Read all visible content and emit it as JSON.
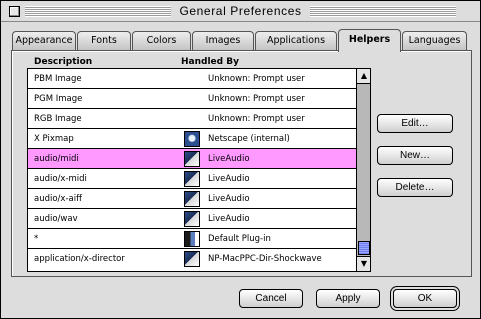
{
  "window": {
    "title": "General Preferences"
  },
  "tabs": [
    {
      "label": "Appearance",
      "active": false
    },
    {
      "label": "Fonts",
      "active": false
    },
    {
      "label": "Colors",
      "active": false
    },
    {
      "label": "Images",
      "active": false
    },
    {
      "label": "Applications",
      "active": false
    },
    {
      "label": "Helpers",
      "active": true
    },
    {
      "label": "Languages",
      "active": false
    }
  ],
  "table": {
    "columns": {
      "description": "Description",
      "handled_by": "Handled By"
    },
    "rows": [
      {
        "description": "PBM Image",
        "handled_by": "Unknown: Prompt user",
        "icon": "none",
        "selected": false
      },
      {
        "description": "PGM Image",
        "handled_by": "Unknown: Prompt user",
        "icon": "none",
        "selected": false
      },
      {
        "description": "RGB Image",
        "handled_by": "Unknown: Prompt user",
        "icon": "none",
        "selected": false
      },
      {
        "description": "X Pixmap",
        "handled_by": "Netscape (internal)",
        "icon": "netscape-icon",
        "selected": false
      },
      {
        "description": "audio/midi",
        "handled_by": "LiveAudio",
        "icon": "plugin-icon",
        "selected": true
      },
      {
        "description": "audio/x-midi",
        "handled_by": "LiveAudio",
        "icon": "plugin-icon",
        "selected": false
      },
      {
        "description": "audio/x-aiff",
        "handled_by": "LiveAudio",
        "icon": "plugin-icon",
        "selected": false
      },
      {
        "description": "audio/wav",
        "handled_by": "LiveAudio",
        "icon": "plugin-icon",
        "selected": false
      },
      {
        "description": "*",
        "handled_by": "Default Plug-in",
        "icon": "plugin-icon",
        "selected": false
      },
      {
        "description": "application/x-director",
        "handled_by": "NP-MacPPC-Dir-Shockwave",
        "icon": "plugin-icon",
        "selected": false
      }
    ]
  },
  "side_buttons": {
    "edit": "Edit…",
    "new": "New…",
    "delete": "Delete…"
  },
  "footer_buttons": {
    "cancel": "Cancel",
    "apply": "Apply",
    "ok": "OK"
  },
  "scrollbar": {
    "up_glyph": "▲",
    "down_glyph": "▼",
    "position_fraction": 0.93
  },
  "colors": {
    "selection": "#ff99ff",
    "window_bg": "#dddddd",
    "scroll_thumb": "#7f8cf5"
  }
}
